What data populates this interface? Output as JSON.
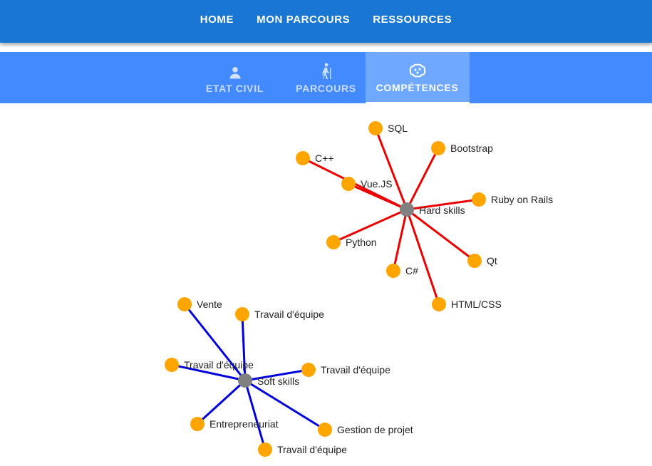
{
  "nav": {
    "items": [
      {
        "label": "HOME"
      },
      {
        "label": "MON PARCOURS"
      },
      {
        "label": "RESSOURCES"
      }
    ]
  },
  "tabs": [
    {
      "label": "ETAT CIVIL",
      "icon": "person-icon"
    },
    {
      "label": "PARCOURS",
      "icon": "hiker-icon"
    },
    {
      "label": "COMPÉTENCES",
      "icon": "brain-icon",
      "active": true
    }
  ],
  "colors": {
    "nav_bg": "#1976d2",
    "tab_bg": "#448aff",
    "hard_link": "#ee0000",
    "soft_link": "#0000dd",
    "node": "#ffa500",
    "hub": "#808080"
  },
  "graph": {
    "hubs": [
      {
        "label": "Hard skills",
        "link_color": "#ee0000",
        "skills": [
          "SQL",
          "Bootstrap",
          "C++",
          "Vue.JS",
          "Ruby on Rails",
          "Python",
          "C#",
          "Qt",
          "HTML/CSS"
        ]
      },
      {
        "label": "Soft skills",
        "link_color": "#0000dd",
        "skills": [
          "Vente",
          "Travail d'équipe",
          "Travail d'équipe",
          "Travail d'équipe",
          "Entrepreneuriat",
          "Gestion de projet",
          "Travail d'équipe"
        ]
      }
    ]
  }
}
